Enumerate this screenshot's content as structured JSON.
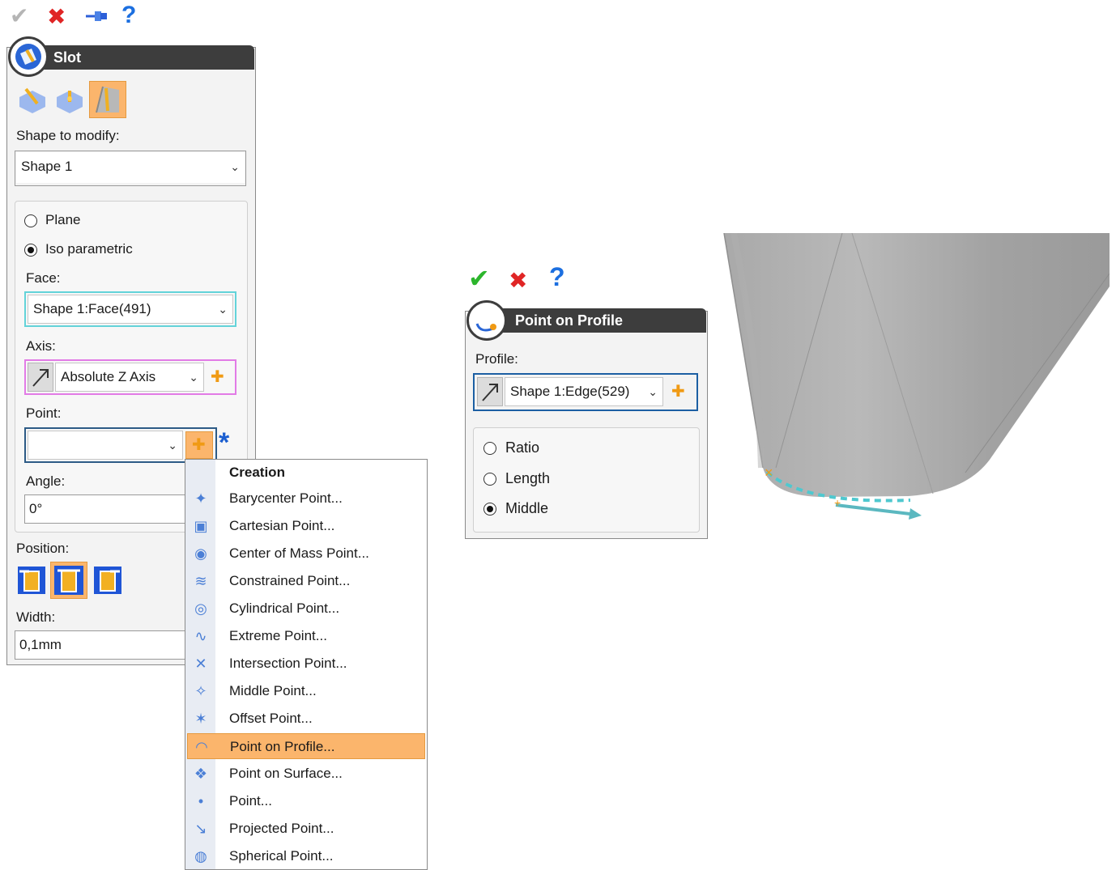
{
  "toolbar_left": {
    "ok_icon": "check-icon",
    "cancel_icon": "cross-icon",
    "pin_icon": "pin-icon",
    "help_label": "?"
  },
  "slot_panel": {
    "title": "Slot",
    "shape_label": "Shape to modify:",
    "shape_value": "Shape 1",
    "radio_plane": "Plane",
    "radio_iso": "Iso parametric",
    "face_label": "Face:",
    "face_value": "Shape 1:Face(491)",
    "axis_label": "Axis:",
    "axis_value": "Absolute Z Axis",
    "point_label": "Point:",
    "point_value": "",
    "required_marker": "*",
    "angle_label": "Angle:",
    "angle_value": "0°",
    "position_label": "Position:",
    "width_label": "Width:",
    "width_value": "0,1mm"
  },
  "creation_menu": {
    "header": "Creation",
    "items": [
      {
        "label": "Barycenter Point...",
        "icon": "barycenter-point-icon"
      },
      {
        "label": "Cartesian Point...",
        "icon": "cartesian-point-icon"
      },
      {
        "label": "Center of Mass Point...",
        "icon": "center-of-mass-icon"
      },
      {
        "label": "Constrained Point...",
        "icon": "constrained-point-icon"
      },
      {
        "label": "Cylindrical Point...",
        "icon": "cylindrical-point-icon"
      },
      {
        "label": "Extreme Point...",
        "icon": "extreme-point-icon"
      },
      {
        "label": "Intersection Point...",
        "icon": "intersection-point-icon"
      },
      {
        "label": "Middle Point...",
        "icon": "middle-point-icon"
      },
      {
        "label": "Offset Point...",
        "icon": "offset-point-icon"
      },
      {
        "label": "Point on Profile...",
        "icon": "point-on-profile-icon",
        "selected": true
      },
      {
        "label": "Point on Surface...",
        "icon": "point-on-surface-icon"
      },
      {
        "label": "Point...",
        "icon": "point-icon"
      },
      {
        "label": "Projected Point...",
        "icon": "projected-point-icon"
      },
      {
        "label": "Spherical Point...",
        "icon": "spherical-point-icon"
      }
    ]
  },
  "profile_panel": {
    "title": "Point on Profile",
    "profile_label": "Profile:",
    "profile_value": "Shape 1:Edge(529)",
    "radio_ratio": "Ratio",
    "radio_length": "Length",
    "radio_middle": "Middle",
    "help_label": "?"
  },
  "colors": {
    "header_bg": "#3d3d3d",
    "accent_orange": "#f09a14",
    "face_frame": "#63d3d9",
    "axis_frame": "#e27be6",
    "menu_selected": "#fbb56c"
  }
}
